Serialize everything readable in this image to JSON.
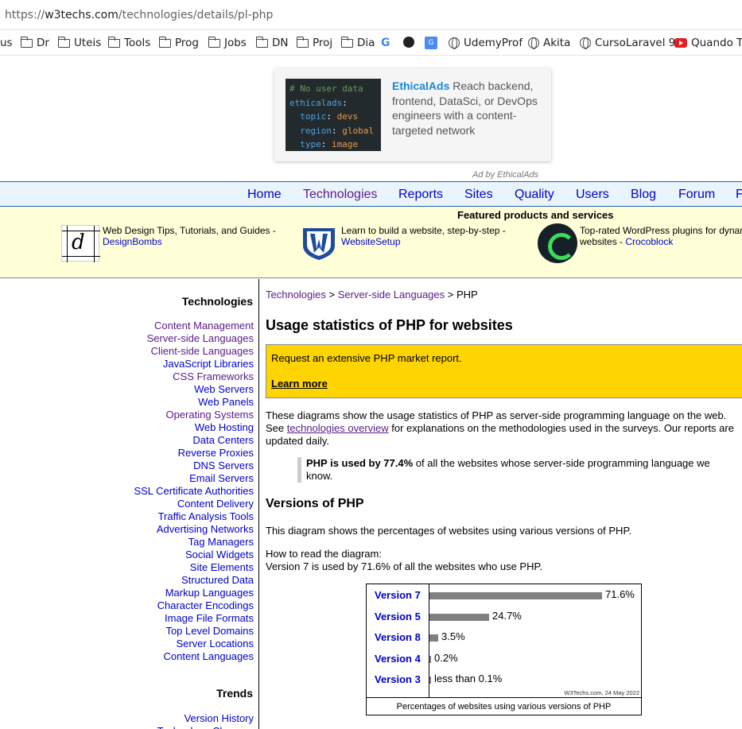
{
  "browser": {
    "url_prefix": "https://",
    "url_host": "w3techs.com",
    "url_path": "/technologies/details/pl-php",
    "bookmarks": [
      {
        "label": "us",
        "icon": "none"
      },
      {
        "label": "Dr",
        "icon": "folder-icon"
      },
      {
        "label": "Uteis",
        "icon": "folder-icon"
      },
      {
        "label": "Tools",
        "icon": "folder-icon"
      },
      {
        "label": "Prog",
        "icon": "folder-icon"
      },
      {
        "label": "Jobs",
        "icon": "folder-icon"
      },
      {
        "label": "DN",
        "icon": "folder-icon"
      },
      {
        "label": "Proj",
        "icon": "folder-icon"
      },
      {
        "label": "Dia",
        "icon": "folder-icon"
      },
      {
        "label": "",
        "icon": "google-icon"
      },
      {
        "label": "",
        "icon": "github-icon"
      },
      {
        "label": "",
        "icon": "translate-icon"
      },
      {
        "label": "UdemyProf",
        "icon": "globe-icon"
      },
      {
        "label": "Akita",
        "icon": "globe-icon"
      },
      {
        "label": "CursoLaravel 9",
        "icon": "globe-icon"
      },
      {
        "label": "Quando Tu",
        "icon": "youtube-icon"
      }
    ]
  },
  "ad": {
    "code_lines": [
      "# No user data",
      "ethicalads:",
      "  topic: devs",
      "  region: global",
      "  type: image"
    ],
    "brand": "EthicalAds",
    "text": " Reach backend, frontend, DataSci, or DevOps engineers with a content-targeted network",
    "by": "Ad by EthicalAds"
  },
  "nav": {
    "items": [
      "Home",
      "Technologies",
      "Reports",
      "Sites",
      "Quality",
      "Users",
      "Blog",
      "Forum",
      "F"
    ],
    "current": "Technologies"
  },
  "featured": {
    "title": "Featured products and services",
    "items": [
      {
        "text": "Web Design Tips, Tutorials, and Guides - ",
        "link": "DesignBombs"
      },
      {
        "text": "Learn to build a website, step-by-step - ",
        "link": "WebsiteSetup"
      },
      {
        "text": "Top-rated WordPress plugins for dynam",
        "text2": "websites - ",
        "link": "Crocoblock"
      }
    ]
  },
  "sidebar": {
    "heading": "Technologies",
    "items": [
      "Content Management",
      "Server-side Languages",
      "Client-side Languages",
      "JavaScript Libraries",
      "CSS Frameworks",
      "Web Servers",
      "Web Panels",
      "Operating Systems",
      "Web Hosting",
      "Data Centers",
      "Reverse Proxies",
      "DNS Servers",
      "Email Servers",
      "SSL Certificate Authorities",
      "Content Delivery",
      "Traffic Analysis Tools",
      "Advertising Networks",
      "Tag Managers",
      "Social Widgets",
      "Site Elements",
      "Structured Data",
      "Markup Languages",
      "Character Encodings",
      "Image File Formats",
      "Top Level Domains",
      "Server Locations",
      "Content Languages"
    ],
    "visited": [
      "Content Management",
      "Server-side Languages",
      "Client-side Languages",
      "CSS Frameworks",
      "Operating Systems"
    ],
    "trends_heading": "Trends",
    "trends_items": [
      "Version History",
      "Technology Changes"
    ]
  },
  "main": {
    "breadcrumb": [
      "Technologies",
      "Server-side Languages",
      "PHP"
    ],
    "title": "Usage statistics of PHP for websites",
    "report_text": "Request an extensive PHP market report.",
    "report_link": "Learn more",
    "intro_1": "These diagrams show the usage statistics of PHP as server-side programming language on the web. See ",
    "intro_link": "technologies overview",
    "intro_2": " for explanations on the methodologies used in the surveys. Our reports are updated daily.",
    "quote_bold": "PHP is used by 77.4%",
    "quote_rest": " of all the websites whose server-side programming language we know.",
    "versions_heading": "Versions of PHP",
    "versions_text": "This diagram shows the percentages of websites using various versions of PHP.",
    "howto_1": "How to read the diagram:",
    "howto_2": "Version 7 is used by 71.6% of all the websites who use PHP."
  },
  "chart_data": {
    "type": "bar",
    "orientation": "horizontal",
    "categories": [
      "Version 7",
      "Version 5",
      "Version 8",
      "Version 4",
      "Version 3"
    ],
    "values": [
      71.6,
      24.7,
      3.5,
      0.2,
      0.05
    ],
    "value_labels": [
      "71.6%",
      "24.7%",
      "3.5%",
      "0.2%",
      "less than 0.1%"
    ],
    "caption": "Percentages of websites using various versions of PHP",
    "credit": "W3Techs.com, 24 May 2022",
    "bar_color": "#808080"
  }
}
